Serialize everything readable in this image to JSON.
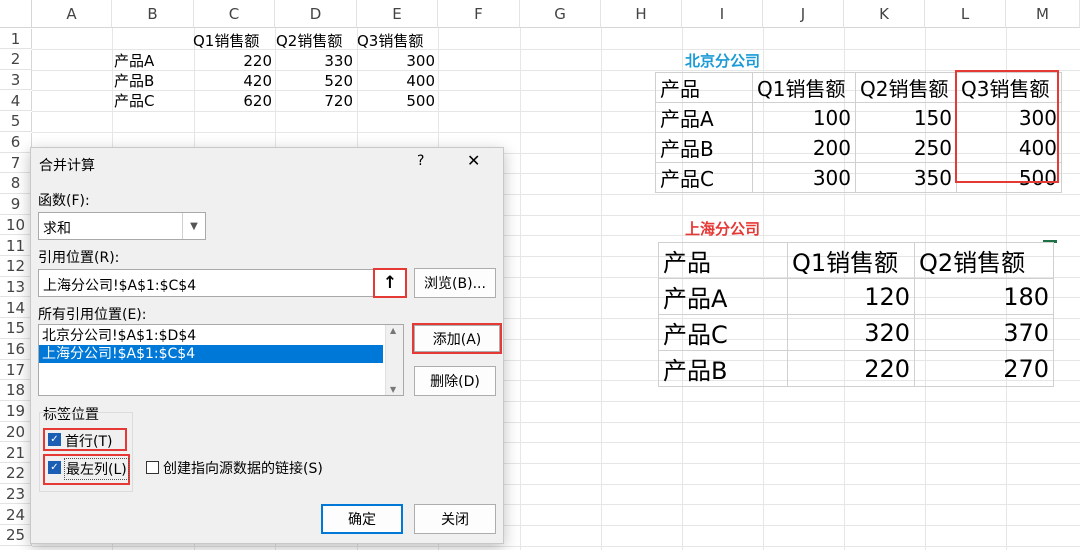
{
  "spreadsheet": {
    "columns": [
      "A",
      "B",
      "C",
      "D",
      "E",
      "F",
      "G",
      "H",
      "I",
      "J",
      "K",
      "L",
      "M"
    ],
    "rows": [
      "1",
      "2",
      "3",
      "4",
      "5",
      "6",
      "7",
      "8",
      "9",
      "10",
      "11",
      "12",
      "13",
      "14",
      "15",
      "16",
      "17",
      "18",
      "19",
      "20",
      "21",
      "22",
      "23",
      "24",
      "25"
    ],
    "header_row": [
      "Q1销售额",
      "Q2销售额",
      "Q3销售额"
    ],
    "data_rows": [
      {
        "name": "产品A",
        "v1": "220",
        "v2": "330",
        "v3": "300"
      },
      {
        "name": "产品B",
        "v1": "420",
        "v2": "520",
        "v3": "400"
      },
      {
        "name": "产品C",
        "v1": "620",
        "v2": "720",
        "v3": "500"
      }
    ]
  },
  "beijing": {
    "title": "北京分公司",
    "title_color": "#1a9ad6",
    "headers": [
      "产品",
      "Q1销售额",
      "Q2销售额",
      "Q3销售额"
    ],
    "rows": [
      [
        "产品A",
        "100",
        "150",
        "300"
      ],
      [
        "产品B",
        "200",
        "250",
        "400"
      ],
      [
        "产品C",
        "300",
        "350",
        "500"
      ]
    ]
  },
  "shanghai": {
    "title": "上海分公司",
    "title_color": "#e53935",
    "headers": [
      "产品",
      "Q1销售额",
      "Q2销售额"
    ],
    "rows": [
      [
        "产品A",
        "120",
        "180"
      ],
      [
        "产品C",
        "320",
        "370"
      ],
      [
        "产品B",
        "220",
        "270"
      ]
    ]
  },
  "dialog": {
    "title": "合并计算",
    "help": "?",
    "close": "✕",
    "function_label": "函数(F):",
    "function_value": "求和",
    "ref_label": "引用位置(R):",
    "ref_value": "上海分公司!$A$1:$C$4",
    "browse_button": "浏览(B)...",
    "all_refs_label": "所有引用位置(E):",
    "all_refs": [
      "北京分公司!$A$1:$D$4",
      "上海分公司!$A$1:$C$4"
    ],
    "add_button": "添加(A)",
    "delete_button": "删除(D)",
    "label_group": "标签位置",
    "top_row": "首行(T)",
    "left_col": "最左列(L)",
    "create_links": "创建指向源数据的链接(S)",
    "ok_button": "确定",
    "close_button": "关闭",
    "accent_color": "#0078d7",
    "highlight_color": "#e53935"
  }
}
